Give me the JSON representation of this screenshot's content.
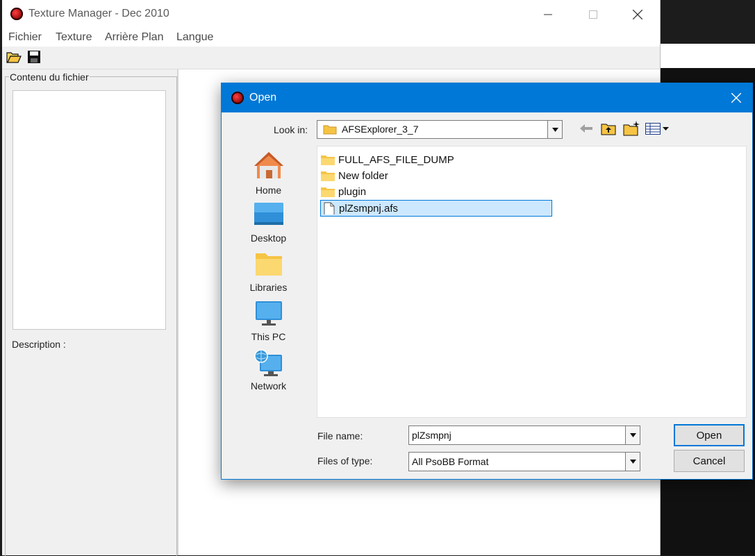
{
  "app": {
    "title": "Texture Manager - Dec 2010",
    "menu": [
      "Fichier",
      "Texture",
      "Arrière Plan",
      "Langue"
    ],
    "content_group_label": "Contenu du fichier",
    "description_label": "Description :"
  },
  "dialog": {
    "title": "Open",
    "look_in_label": "Look in:",
    "look_in_value": "AFSExplorer_3_7",
    "places": [
      "Home",
      "Desktop",
      "Libraries",
      "This PC",
      "Network"
    ],
    "files": [
      {
        "name": "FULL_AFS_FILE_DUMP",
        "type": "folder"
      },
      {
        "name": "New folder",
        "type": "folder"
      },
      {
        "name": "plugin",
        "type": "folder"
      },
      {
        "name": "plZsmpnj.afs",
        "type": "file",
        "selected": true
      }
    ],
    "file_name_label": "File name:",
    "file_name_value": "plZsmpnj",
    "file_type_label": "Files of type:",
    "file_type_value": "All PsoBB Format",
    "open_button": "Open",
    "cancel_button": "Cancel"
  },
  "colors": {
    "accent": "#0078d7",
    "folder": "#f6c445",
    "selection": "#cce8ff"
  }
}
